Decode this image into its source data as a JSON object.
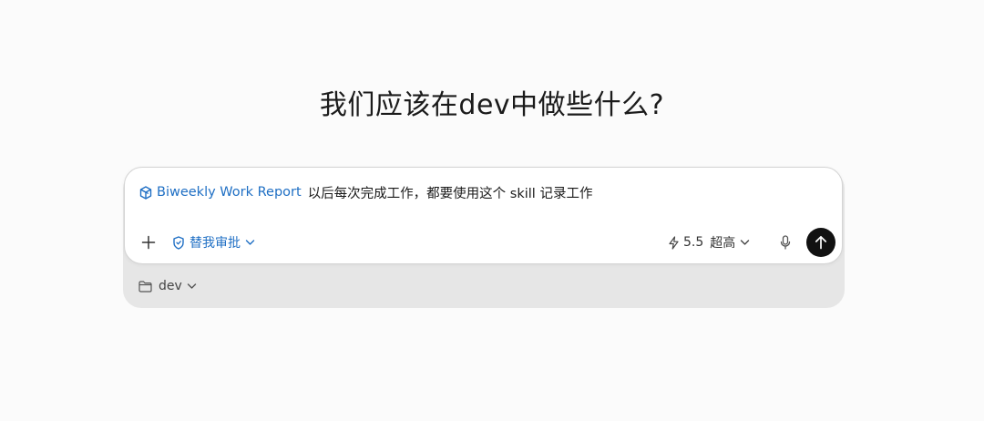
{
  "heading": "我们应该在dev中做些什么?",
  "composer": {
    "skill_chip": {
      "label": "Biweekly Work Report",
      "icon": "cube-icon",
      "color": "#1f6fc4"
    },
    "prompt_text": "以后每次完成工作，都要使用这个 skill 记录工作",
    "toolbar": {
      "add_icon": "plus-icon",
      "approval": {
        "label": "替我审批",
        "icon": "shield-check-icon",
        "dropdown_icon": "chevron-down-icon"
      },
      "model": {
        "icon": "lightning-icon",
        "version": "5.5",
        "level": "超高",
        "dropdown_icon": "chevron-down-icon"
      },
      "mic_icon": "microphone-icon",
      "send_icon": "arrow-up-icon"
    }
  },
  "workspace": {
    "folder_icon": "folder-icon",
    "label": "dev",
    "dropdown_icon": "chevron-down-icon"
  }
}
